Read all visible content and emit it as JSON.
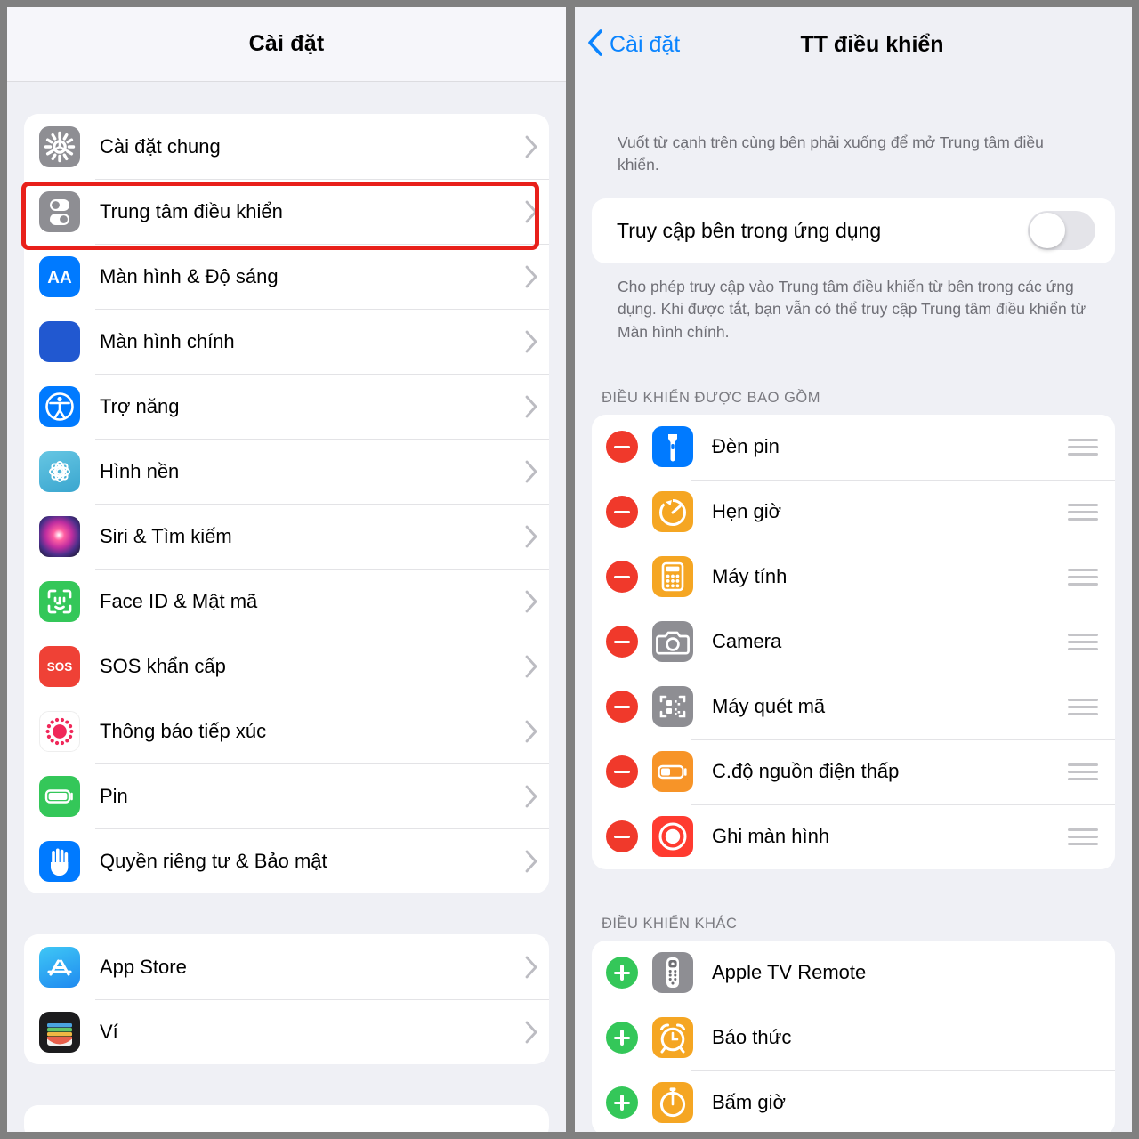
{
  "left_panel": {
    "header": {
      "title": "Cài đặt"
    },
    "group1": [
      {
        "label": "Cài đặt chung",
        "icon": "gear-icon",
        "icon_style": "ic-gray",
        "highlighted": false
      },
      {
        "label": "Trung tâm điều khiển",
        "icon": "control-center-icon",
        "icon_style": "ic-gray",
        "highlighted": true
      },
      {
        "label": "Màn hình & Độ sáng",
        "icon": "display-brightness-icon",
        "icon_style": "ic-blue",
        "highlighted": false
      },
      {
        "label": "Màn hình chính",
        "icon": "home-screen-icon",
        "icon_style": "ic-blue2",
        "highlighted": false
      },
      {
        "label": "Trợ năng",
        "icon": "accessibility-icon",
        "icon_style": "ic-blue",
        "highlighted": false
      },
      {
        "label": "Hình nền",
        "icon": "wallpaper-icon",
        "icon_style": "ic-wall",
        "highlighted": false
      },
      {
        "label": "Siri & Tìm kiếm",
        "icon": "siri-icon",
        "icon_style": "ic-siri",
        "highlighted": false
      },
      {
        "label": "Face ID & Mật mã",
        "icon": "face-id-icon",
        "icon_style": "ic-green",
        "highlighted": false
      },
      {
        "label": "SOS khẩn cấp",
        "icon": "sos-icon",
        "icon_style": "ic-red",
        "highlighted": false
      },
      {
        "label": "Thông báo tiếp xúc",
        "icon": "exposure-notification-icon",
        "icon_style": "ic-white",
        "highlighted": false
      },
      {
        "label": "Pin",
        "icon": "battery-icon",
        "icon_style": "ic-green",
        "highlighted": false
      },
      {
        "label": "Quyền riêng tư & Bảo mật",
        "icon": "privacy-hand-icon",
        "icon_style": "ic-blue",
        "highlighted": false
      }
    ],
    "group2": [
      {
        "label": "App Store",
        "icon": "app-store-icon",
        "icon_style": "ic-appstore"
      },
      {
        "label": "Ví",
        "icon": "wallet-icon",
        "icon_style": "ic-black"
      }
    ],
    "chevron": "chevron-right-icon"
  },
  "right_panel": {
    "header": {
      "back_label": "Cài đặt",
      "back_icon": "chevron-left-icon",
      "title": "TT điều khiển"
    },
    "intro_note": "Vuốt từ cạnh trên cùng bên phải xuống để mở Trung tâm điều khiển.",
    "toggle": {
      "label": "Truy cập bên trong ứng dụng",
      "state": "off",
      "highlighted": true
    },
    "toggle_note": "Cho phép truy cập vào Trung tâm điều khiển từ bên trong các ứng dụng. Khi được tắt, bạn vẫn có thể truy cập Trung tâm điều khiển từ Màn hình chính.",
    "included_section": {
      "header": "ĐIỀU KHIỂN ĐƯỢC BAO GỒM",
      "items": [
        {
          "label": "Đèn pin",
          "icon": "flashlight-icon",
          "icon_style": "ic-blue",
          "action": "minus",
          "handle": "drag-handle-icon"
        },
        {
          "label": "Hẹn giờ",
          "icon": "timer-icon",
          "icon_style": "ic-orange",
          "action": "minus",
          "handle": "drag-handle-icon"
        },
        {
          "label": "Máy tính",
          "icon": "calculator-icon",
          "icon_style": "ic-orange",
          "action": "minus",
          "handle": "drag-handle-icon"
        },
        {
          "label": "Camera",
          "icon": "camera-icon",
          "icon_style": "ic-gray",
          "action": "minus",
          "handle": "drag-handle-icon"
        },
        {
          "label": "Máy quét mã",
          "icon": "code-scanner-icon",
          "icon_style": "ic-gray",
          "action": "minus",
          "handle": "drag-handle-icon"
        },
        {
          "label": "C.độ nguồn điện thấp",
          "icon": "low-power-mode-icon",
          "icon_style": "ic-orange2",
          "action": "minus",
          "handle": "drag-handle-icon"
        },
        {
          "label": "Ghi màn hình",
          "icon": "screen-record-icon",
          "icon_style": "ic-redpure",
          "action": "minus",
          "handle": "drag-handle-icon"
        }
      ]
    },
    "more_section": {
      "header": "ĐIỀU KHIỂN KHÁC",
      "items": [
        {
          "label": "Apple TV Remote",
          "icon": "apple-tv-remote-icon",
          "icon_style": "ic-gray",
          "action": "plus"
        },
        {
          "label": "Báo thức",
          "icon": "alarm-icon",
          "icon_style": "ic-orange",
          "action": "plus"
        },
        {
          "label": "Bấm giờ",
          "icon": "stopwatch-icon",
          "icon_style": "ic-orange",
          "action": "plus"
        }
      ]
    }
  },
  "colors": {
    "accent_blue": "#0a84ff",
    "highlight_red": "#e8201a",
    "panel_bg": "#eff0f5",
    "card_bg": "#ffffff",
    "remove_red": "#f0392b",
    "add_green": "#34c759",
    "frame_gray": "#808080"
  }
}
